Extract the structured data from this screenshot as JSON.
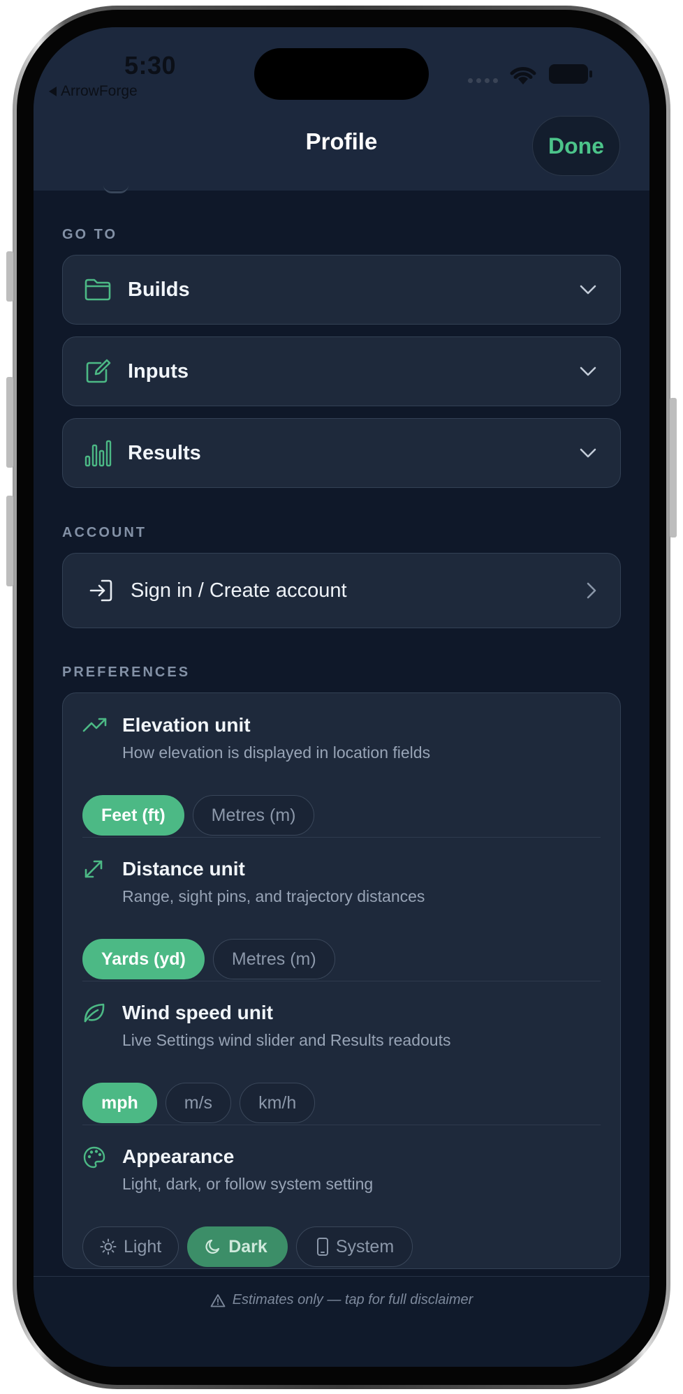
{
  "status_bar": {
    "time": "5:30",
    "back_app": "ArrowForge"
  },
  "header": {
    "title": "Profile",
    "done_label": "Done"
  },
  "sections": {
    "goto": {
      "label": "GO TO",
      "items": [
        {
          "label": "Builds",
          "icon": "folder-icon"
        },
        {
          "label": "Inputs",
          "icon": "edit-icon"
        },
        {
          "label": "Results",
          "icon": "bar-chart-icon"
        }
      ]
    },
    "account": {
      "label": "ACCOUNT",
      "sign_in": "Sign in / Create account"
    },
    "preferences": {
      "label": "PREFERENCES",
      "items": [
        {
          "title": "Elevation unit",
          "desc": "How elevation is displayed in location fields",
          "options": [
            "Feet (ft)",
            "Metres (m)"
          ],
          "selected": "Feet (ft)"
        },
        {
          "title": "Distance unit",
          "desc": "Range, sight pins, and trajectory distances",
          "options": [
            "Yards (yd)",
            "Metres (m)"
          ],
          "selected": "Yards (yd)"
        },
        {
          "title": "Wind speed unit",
          "desc": "Live Settings wind slider and Results readouts",
          "options": [
            "mph",
            "m/s",
            "km/h"
          ],
          "selected": "mph"
        },
        {
          "title": "Appearance",
          "desc": "Light, dark, or follow system setting",
          "options": [
            "Light",
            "Dark",
            "System"
          ],
          "selected": "Dark"
        }
      ]
    }
  },
  "footer": {
    "disclaimer": "Estimates only — tap for full disclaimer"
  },
  "colors": {
    "accent": "#4cb985",
    "background": "#0f1829",
    "card": "#1e293b",
    "header": "#1c283d"
  }
}
